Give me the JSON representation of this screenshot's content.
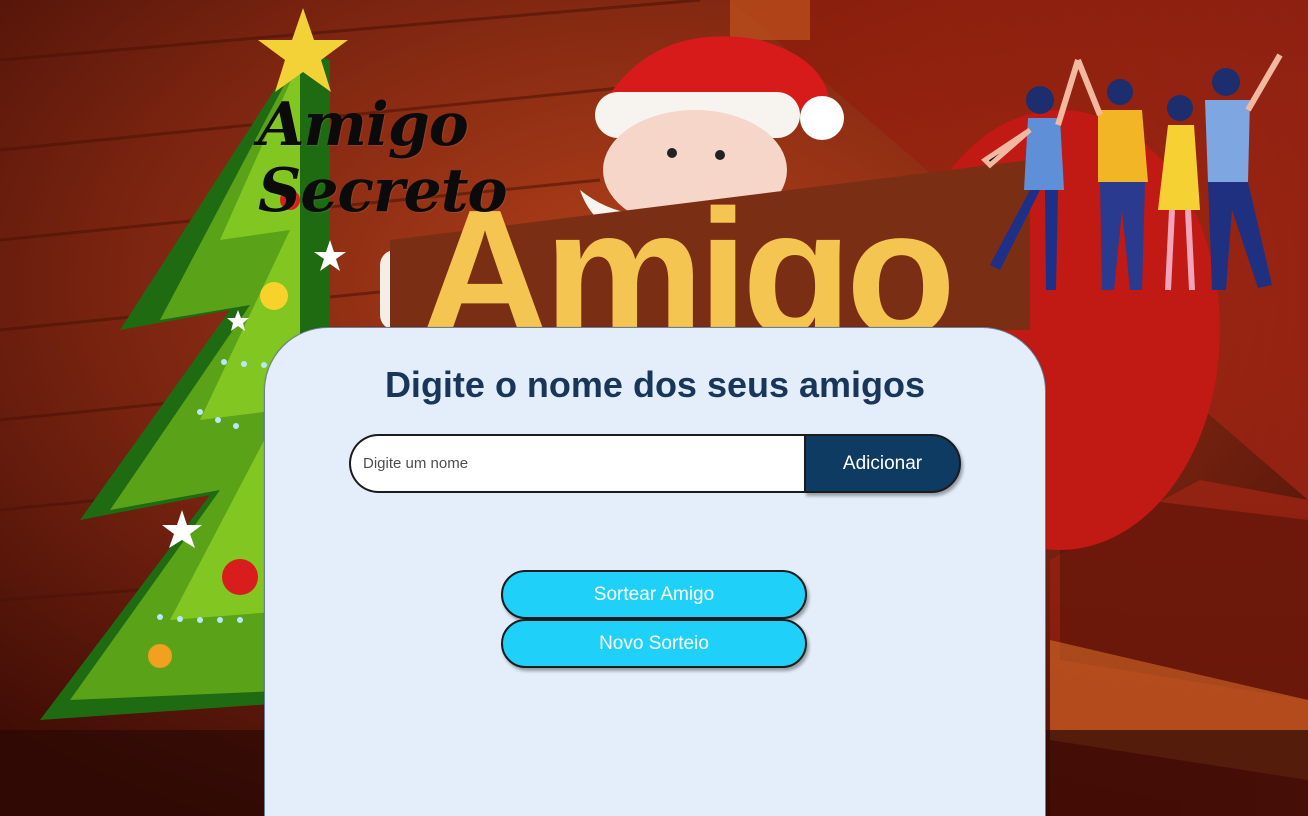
{
  "header": {
    "title_line1": "Amigo",
    "title_line2": "Secreto"
  },
  "main": {
    "heading": "Digite o nome dos seus amigos",
    "name_input": {
      "value": "",
      "placeholder": "Digite um nome"
    },
    "add_button_label": "Adicionar",
    "draw_button_label": "Sortear Amigo",
    "new_draw_button_label": "Novo Sorteio"
  },
  "background": {
    "sign_text": "Amigo"
  },
  "colors": {
    "card_bg": "#e3eefa",
    "heading": "#17365a",
    "add_button": "#0e3b62",
    "action_button": "#1fd1f9"
  }
}
